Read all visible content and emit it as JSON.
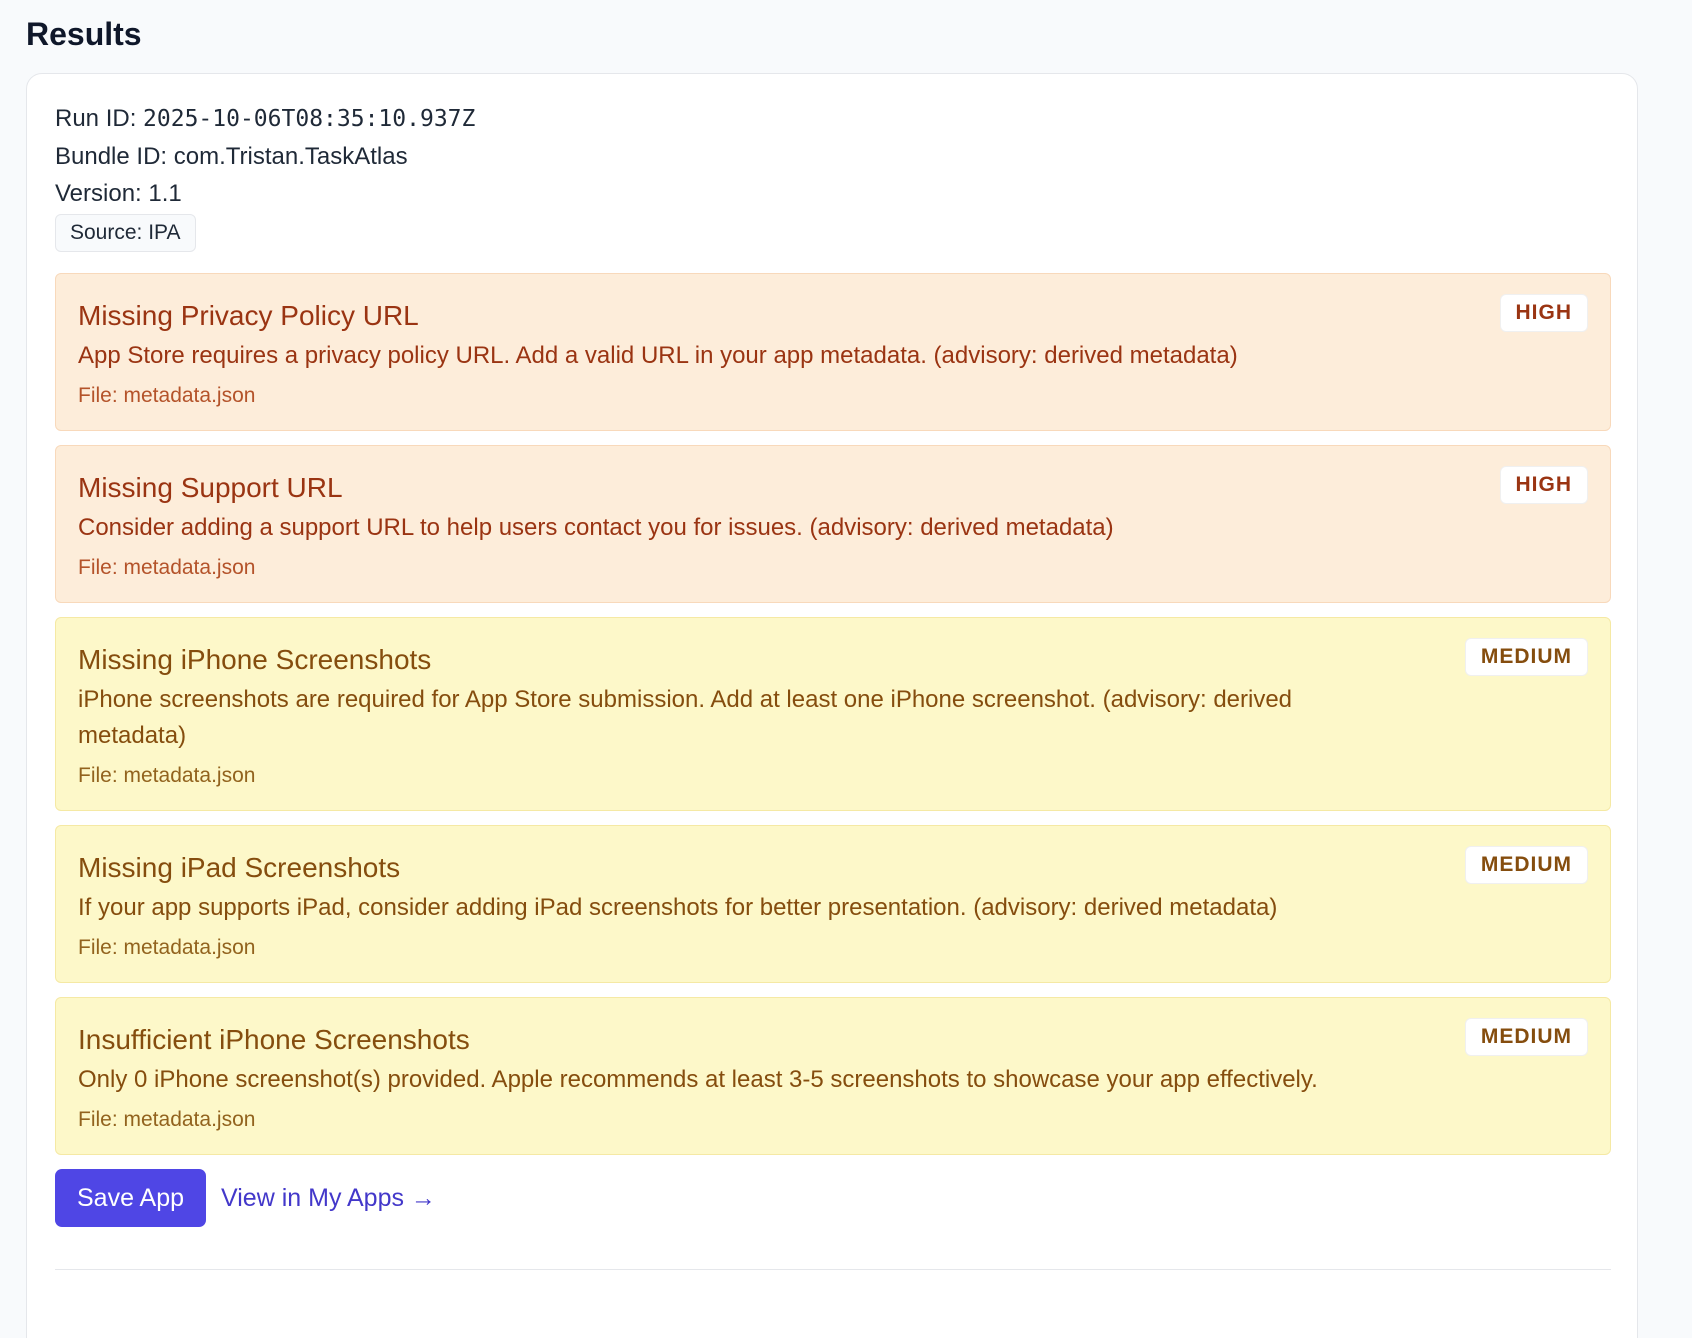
{
  "header": {
    "title": "Results"
  },
  "run": {
    "run_id_label": "Run ID: ",
    "run_id": "2025-10-06T08:35:10.937Z",
    "bundle_id_label": "Bundle ID: ",
    "bundle_id": "com.Tristan.TaskAtlas",
    "version_label": "Version: ",
    "version": "1.1",
    "source": "Source: IPA"
  },
  "issues": [
    {
      "severity": "HIGH",
      "title": "Missing Privacy Policy URL",
      "description": "App Store requires a privacy policy URL. Add a valid URL in your app metadata. (advisory: derived metadata)",
      "file": "File: metadata.json"
    },
    {
      "severity": "HIGH",
      "title": "Missing Support URL",
      "description": "Consider adding a support URL to help users contact you for issues. (advisory: derived metadata)",
      "file": "File: metadata.json"
    },
    {
      "severity": "MEDIUM",
      "title": "Missing iPhone Screenshots",
      "description": "iPhone screenshots are required for App Store submission. Add at least one iPhone screenshot. (advisory: derived metadata)",
      "file": "File: metadata.json"
    },
    {
      "severity": "MEDIUM",
      "title": "Missing iPad Screenshots",
      "description": "If your app supports iPad, consider adding iPad screenshots for better presentation. (advisory: derived metadata)",
      "file": "File: metadata.json"
    },
    {
      "severity": "MEDIUM",
      "title": "Insufficient iPhone Screenshots",
      "description": "Only 0 iPhone screenshot(s) provided. Apple recommends at least 3-5 screenshots to showcase your app effectively.",
      "file": "File: metadata.json"
    }
  ],
  "actions": {
    "save_label": "Save App",
    "view_label": "View in My Apps →"
  },
  "colors": {
    "accent": "#4f46e5",
    "high_bg": "#fdedda",
    "medium_bg": "#fdf8c9"
  }
}
